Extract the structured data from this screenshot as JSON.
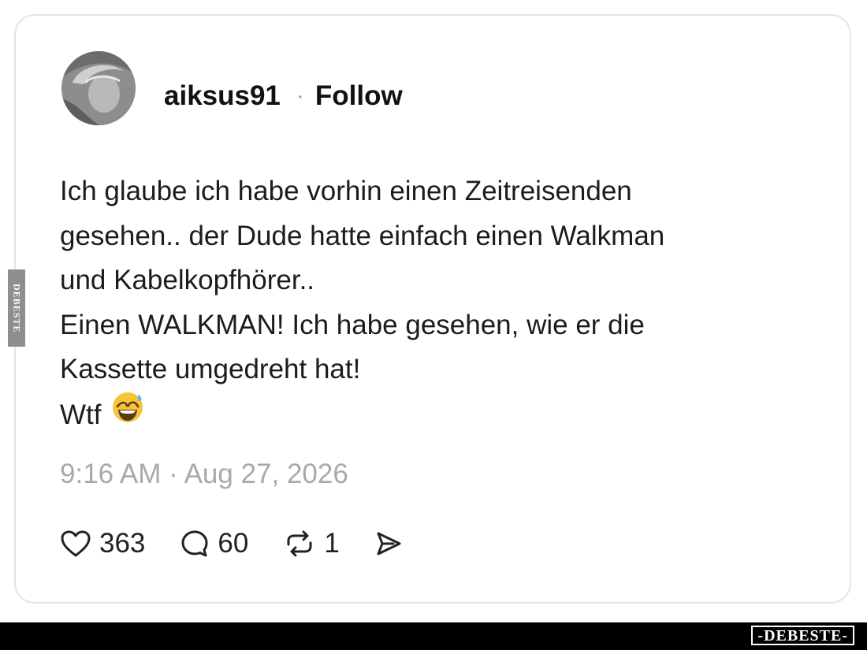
{
  "post": {
    "username": "aiksus91",
    "separator": "·",
    "follow_label": "Follow",
    "lines": [
      "Ich glaube ich habe vorhin einen Zeitreisenden",
      "gesehen.. der Dude hatte einfach einen Walkman",
      "und Kabelkopfhörer..",
      "Einen WALKMAN! Ich habe gesehen, wie er die",
      "Kassette umgedreht hat!",
      "Wtf"
    ],
    "emoji_icon": "grinning-sweat-emoji",
    "timestamp": "9:16 AM · Aug 27, 2026",
    "likes": "363",
    "replies": "60",
    "reposts": "1"
  },
  "icons": {
    "like": "heart-icon",
    "reply": "speech-bubble-icon",
    "repost": "repost-arrows-icon",
    "share": "send-icon"
  },
  "watermark": {
    "side_text": "DEBESTE",
    "logo_text": "-DEBESTE-"
  },
  "colors": {
    "text": "#1c1c1c",
    "muted": "#a9a9a9",
    "card_border": "#e4e4e4",
    "footer": "#000000"
  }
}
